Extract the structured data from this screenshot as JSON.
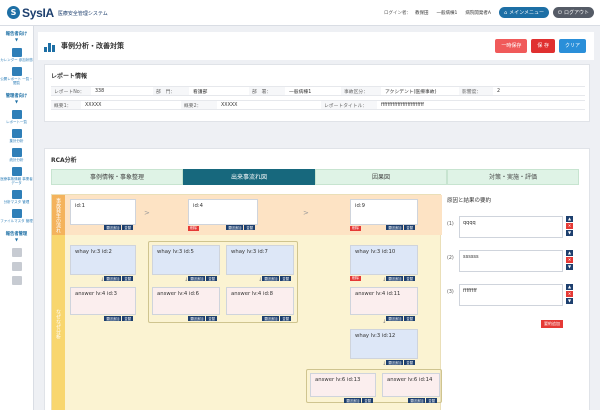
{
  "header": {
    "logo_mark": "S",
    "logo_text": "SysIA",
    "subtitle": "医療安全管理システム",
    "login_label": "ログイン者：",
    "login_name": "教保田",
    "role": "一般病棟1",
    "hospital": "病院開発者A",
    "menu_button": "メインメニュー",
    "logout_button": "ログアウト"
  },
  "sidebar": {
    "section1": "報告者向け",
    "items1": [
      {
        "label": "カレンダー 参加状態"
      },
      {
        "label": "公開レポート 一覧・閲覧"
      }
    ],
    "section2": "管理者向け",
    "items2": [
      {
        "label": "レポート一覧"
      },
      {
        "label": "集計分析"
      },
      {
        "label": "統計分析"
      },
      {
        "label": "医療事故情報 事業者データ"
      },
      {
        "label": "分析マスタ 管理"
      },
      {
        "label": "ファイルマスタ 管理"
      }
    ],
    "section3": "報告者管理"
  },
  "page": {
    "title": "事例分析・改善対策",
    "btn_temp_save": "一時保存",
    "btn_save": "保 存",
    "btn_clear": "クリア"
  },
  "report": {
    "title": "レポート情報",
    "row1": [
      {
        "label": "レポートNo：",
        "value": "338"
      },
      {
        "label": "部　門：",
        "value": "看護部"
      },
      {
        "label": "部　署：",
        "value": "一般病棟1"
      },
      {
        "label": "事故区分：",
        "value": "アクシデント(医療事故)"
      },
      {
        "label": "影響度：",
        "value": "2"
      }
    ],
    "row2": [
      {
        "label": "概要1：",
        "value": "XXXXX"
      },
      {
        "label": "概要2：",
        "value": "XXXXX"
      },
      {
        "label": "レポートタイトル：",
        "value": "ffffffffffffffffffffffffff"
      }
    ]
  },
  "rca": {
    "title": "RCA分析",
    "tabs": [
      "事例情報・事象整理",
      "出来事流れ図",
      "因果図",
      "対策・実施・評価"
    ],
    "active_tab": 1,
    "row_label_1": "事故発生の流れ",
    "row_label_2": "なぜなぜ分析",
    "cards": {
      "c1": "id:1",
      "c4": "id:4",
      "c9": "id:9",
      "c2": "whay lv:3 id:2",
      "c3": "answer lv:4 id:3",
      "c5": "whay lv:3 id:5",
      "c6": "answer lv:4 id:6",
      "c7": "whay lv:3 id:7",
      "c8": "answer lv:4 id:8",
      "c10": "whay lv:3 id:10",
      "c11": "answer lv:4 id:11",
      "c12": "whay lv:3 id:12",
      "c13": "answer lv:6 id:13",
      "c14": "answer lv:6 id:14"
    },
    "tag_delete": "削除",
    "act_add": "要因追加",
    "act_move": "並替"
  },
  "summary": {
    "title": "原因と結果の要約",
    "items": [
      {
        "num": "(1)",
        "text": "qqqq"
      },
      {
        "num": "(2)",
        "text": "ssssss"
      },
      {
        "num": "(3)",
        "text": "ffffffff"
      }
    ],
    "add_button": "要約追加"
  },
  "colors": {
    "primary": "#1d6fa5",
    "active_tab": "#17687d",
    "danger": "#e53935",
    "band_top": "#fde3c4",
    "band_bottom": "#fbf3d2"
  }
}
